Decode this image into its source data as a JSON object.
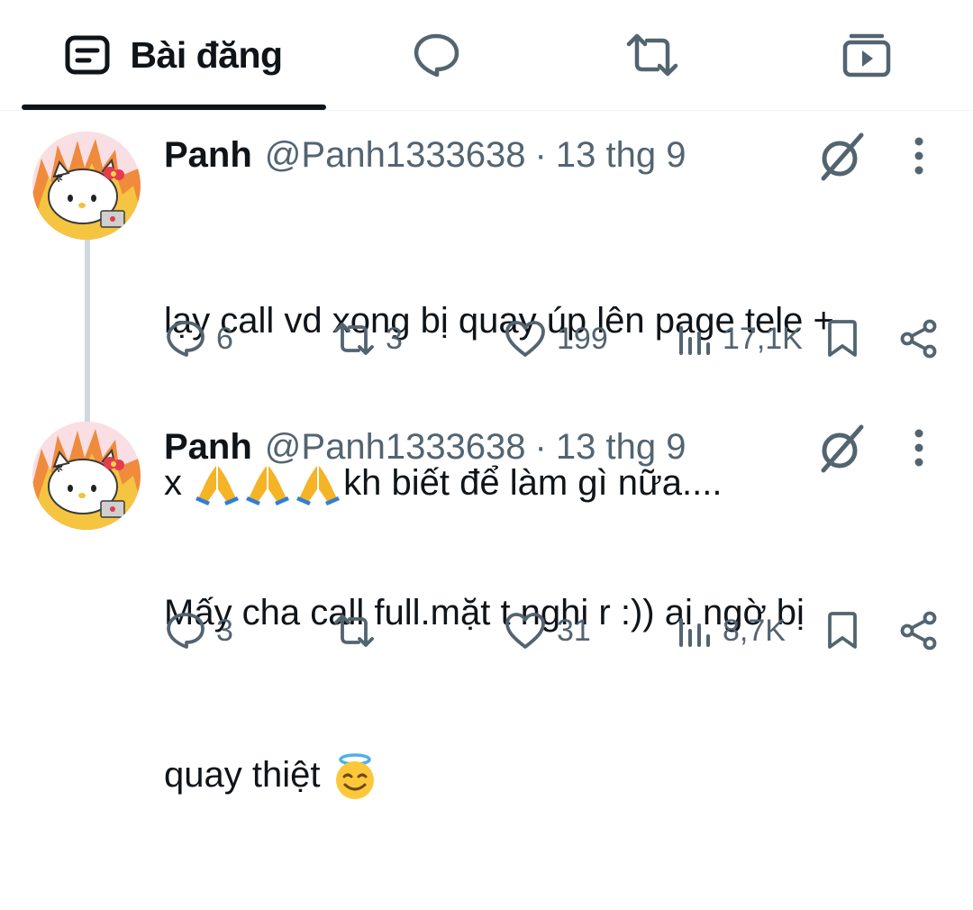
{
  "tabs": {
    "posts_label": "Bài đăng",
    "active": "posts",
    "icons": {
      "posts": "posts-tab-icon",
      "replies": "chat-bubble-icon",
      "reposts": "repost-icon",
      "media": "media-icon"
    }
  },
  "posts": [
    {
      "author": "Panh",
      "handle": "@Panh1333638",
      "separator": "·",
      "time": "13 thg 9",
      "text_line1": "lạy call vd xong bị quay úp lên page tele +",
      "text_line2_prefix": "x ",
      "text_line2_suffix": "kh biết để làm gì nữa....",
      "emojis": [
        "folded-hands",
        "folded-hands",
        "folded-hands"
      ],
      "replies": "6",
      "reposts": "3",
      "likes": "199",
      "views": "17,1K"
    },
    {
      "author": "Panh",
      "handle": "@Panh1333638",
      "separator": "·",
      "time": "13 thg 9",
      "text_line1": "Mấy cha call full.mặt t nghi r :)) ai ngờ bị",
      "text_line2_prefix": "quay thiệt ",
      "emojis": [
        "smiling-face-with-halo"
      ],
      "replies": "3",
      "reposts": "",
      "likes": "31",
      "views": "8,7K"
    }
  ],
  "colors": {
    "text_primary": "#0f1419",
    "text_secondary": "#536471",
    "divider": "#eff3f4",
    "thread_line": "#cfd9de"
  }
}
